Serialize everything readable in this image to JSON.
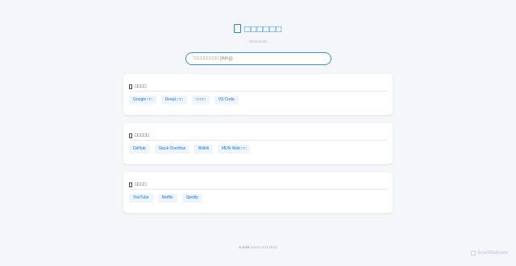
{
  "header": {
    "title": "□□□□□□",
    "subtitle": "□□□□□□□□□"
  },
  "search": {
    "placeholder": "□□□□□□□□□ (Bing)"
  },
  "sections": [
    {
      "title": "□□□□",
      "links": [
        "Google □□",
        "DeepL □□",
        "□□□□",
        "VS Code"
      ]
    },
    {
      "title": "□□□□□",
      "links": [
        "GitHub",
        "Stack Overflow",
        "Bilibili",
        "MDN Web □□"
      ]
    },
    {
      "title": "□□□□",
      "links": [
        "YouTube",
        "Netflix",
        "Spotify"
      ]
    }
  ],
  "footer": {
    "text": "© 2025 □□□□□. □□□□□□□□"
  },
  "watermark": {
    "text": "ScanMalware"
  },
  "colors": {
    "accent": "#1e88e5",
    "link_bg": "#eef5fd",
    "page_bg": "#f4f6f9"
  },
  "icons": {
    "title": "globe-icon",
    "section_0": "tools-icon",
    "section_1": "code-icon",
    "section_2": "media-icon"
  }
}
